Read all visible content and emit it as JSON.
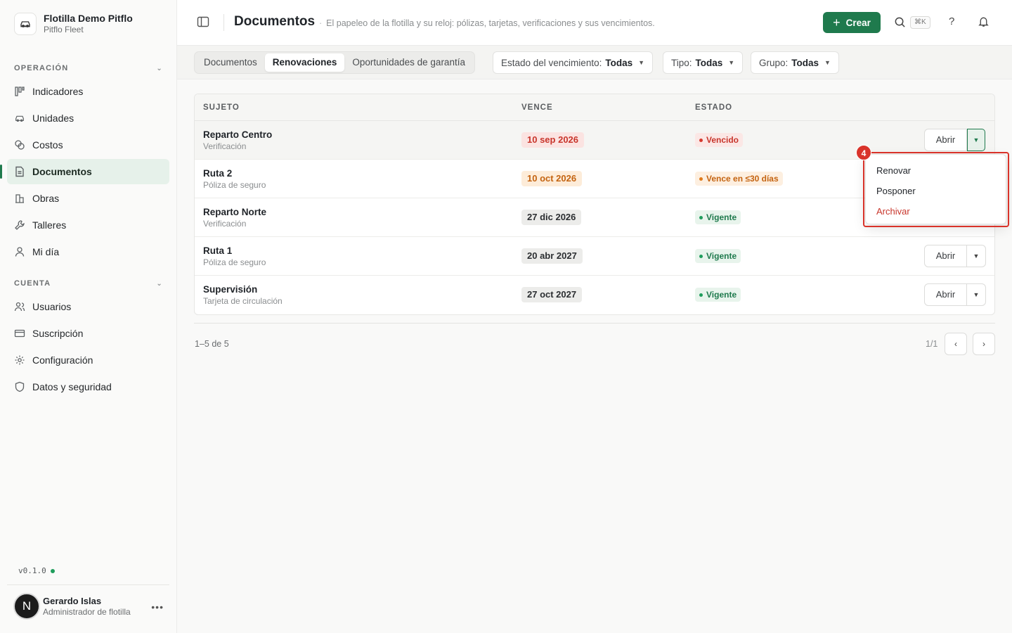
{
  "org": {
    "name": "Flotilla Demo Pitflo",
    "subtitle": "Pitflo Fleet"
  },
  "sidebar": {
    "sections": [
      {
        "title": "OPERACIÓN",
        "items": [
          {
            "label": "Indicadores",
            "icon": "chart-columns-icon"
          },
          {
            "label": "Unidades",
            "icon": "car-icon"
          },
          {
            "label": "Costos",
            "icon": "coins-icon"
          },
          {
            "label": "Documentos",
            "icon": "document-icon",
            "active": true
          },
          {
            "label": "Obras",
            "icon": "building-icon"
          },
          {
            "label": "Talleres",
            "icon": "wrench-icon"
          },
          {
            "label": "Mi día",
            "icon": "user-icon"
          }
        ]
      },
      {
        "title": "CUENTA",
        "items": [
          {
            "label": "Usuarios",
            "icon": "users-icon"
          },
          {
            "label": "Suscripción",
            "icon": "credit-card-icon"
          },
          {
            "label": "Configuración",
            "icon": "gear-icon"
          },
          {
            "label": "Datos y seguridad",
            "icon": "shield-icon"
          }
        ]
      }
    ],
    "version": "v0.1.0",
    "version_status_color": "#1f9d5c"
  },
  "user": {
    "initial": "N",
    "name": "Gerardo Islas",
    "role": "Administrador de flotilla"
  },
  "header": {
    "title": "Documentos",
    "description": "El papeleo de la flotilla y su reloj: pólizas, tarjetas, verificaciones y sus vencimientos.",
    "create_label": "Crear",
    "shortcut": "⌘K",
    "help": "?"
  },
  "toolbar": {
    "tabs": [
      "Documentos",
      "Renovaciones",
      "Oportunidades de garantía"
    ],
    "active_tab": "Renovaciones",
    "filters": [
      {
        "label": "Estado del vencimiento:",
        "value": "Todas"
      },
      {
        "label": "Tipo:",
        "value": "Todas"
      },
      {
        "label": "Grupo:",
        "value": "Todas"
      }
    ]
  },
  "table": {
    "columns": [
      "SUJETO",
      "VENCE",
      "ESTADO"
    ],
    "open_label": "Abrir",
    "rows": [
      {
        "name": "Reparto Centro",
        "type": "Verificación",
        "date": "10 sep 2026",
        "date_tone": "red",
        "status": "Vencido",
        "status_tone": "red"
      },
      {
        "name": "Ruta 2",
        "type": "Póliza de seguro",
        "date": "10 oct 2026",
        "date_tone": "orange",
        "status": "Vence en ≤30 días",
        "status_tone": "orange"
      },
      {
        "name": "Reparto Norte",
        "type": "Verificación",
        "date": "27 dic 2026",
        "date_tone": "neutral",
        "status": "Vigente",
        "status_tone": "green"
      },
      {
        "name": "Ruta 1",
        "type": "Póliza de seguro",
        "date": "20 abr 2027",
        "date_tone": "neutral",
        "status": "Vigente",
        "status_tone": "green"
      },
      {
        "name": "Supervisión",
        "type": "Tarjeta de circulación",
        "date": "27 oct 2027",
        "date_tone": "neutral",
        "status": "Vigente",
        "status_tone": "green"
      }
    ]
  },
  "pagination": {
    "range": "1–5 de 5",
    "pages": "1/1"
  },
  "dropdown": {
    "items": [
      "Renovar",
      "Posponer",
      "Archivar"
    ],
    "badge": "4"
  },
  "colors": {
    "accent": "#1f7a4d",
    "danger": "#c8352b",
    "warning": "#c46310"
  }
}
